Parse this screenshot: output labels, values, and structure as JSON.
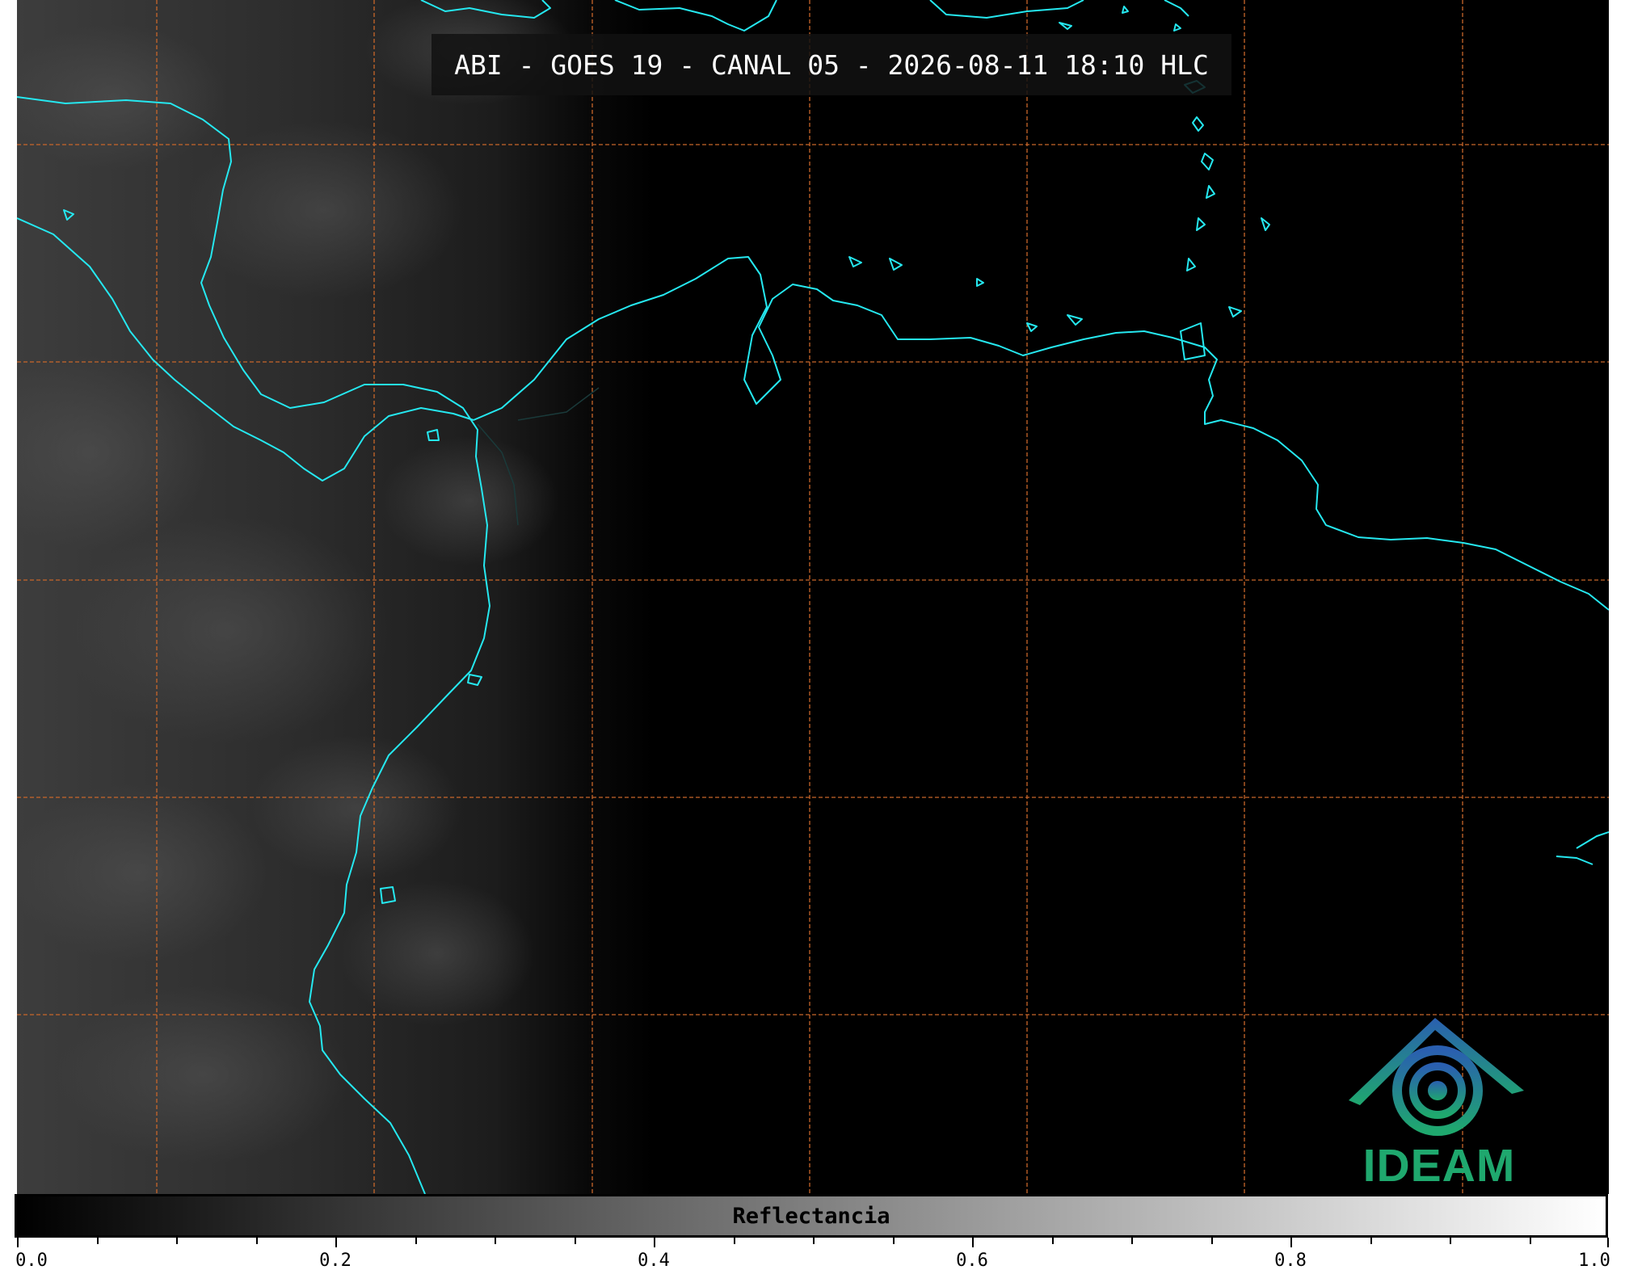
{
  "title": "ABI - GOES 19 - CANAL 05 - 2026-08-11 18:10 HLC",
  "logo": {
    "name": "IDEAM",
    "colors": [
      "#2a5fb0",
      "#1fa86e"
    ]
  },
  "colorbar": {
    "label": "Reflectancia",
    "range": [
      0.0,
      1.0
    ],
    "colormap": "grayscale",
    "tick_labels": [
      "0.0",
      "0.2",
      "0.4",
      "0.6",
      "0.8",
      "1.0"
    ]
  },
  "map": {
    "grid_color": "#c8662a",
    "coastline_color": "#25e8f0",
    "border_color": "#0a1a1a",
    "background": "#000000"
  }
}
